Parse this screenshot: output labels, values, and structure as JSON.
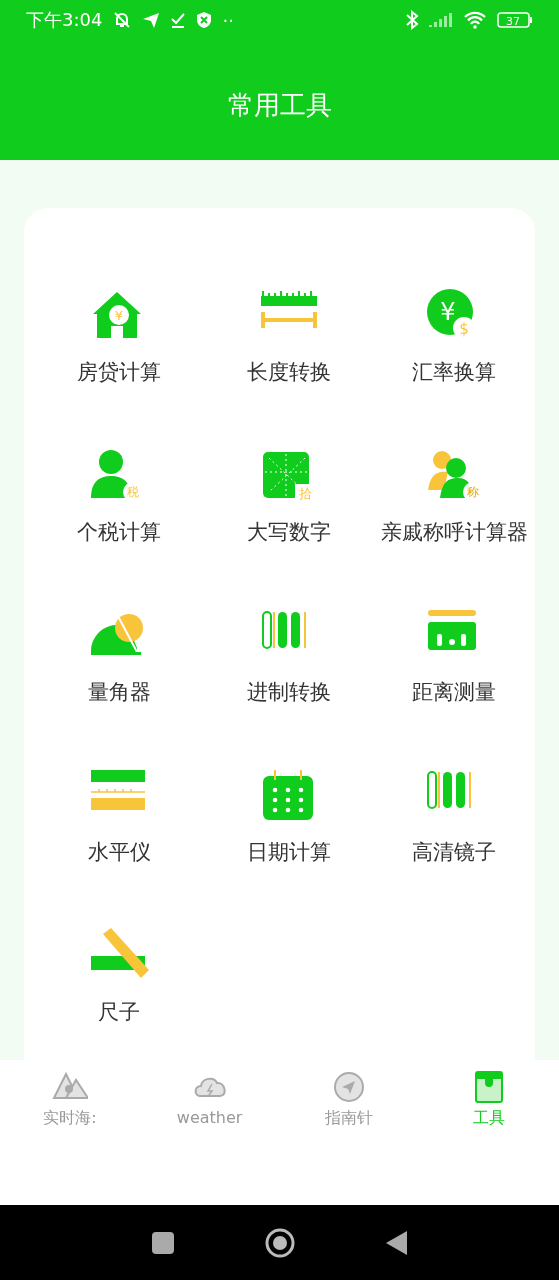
{
  "status_bar": {
    "time": "下午3:04",
    "more": "··",
    "battery": "37"
  },
  "header": {
    "title": "常用工具"
  },
  "tools": [
    {
      "kind": "house",
      "badge": "¥",
      "label": "房贷计算"
    },
    {
      "kind": "ruler",
      "label": "长度转换"
    },
    {
      "kind": "currency",
      "badge": "¥",
      "badge2": "$",
      "label": "汇率换算"
    },
    {
      "kind": "tax",
      "badge": "税",
      "label": "个税计算"
    },
    {
      "kind": "square",
      "badge": "拾",
      "label": "大写数字"
    },
    {
      "kind": "people",
      "badge": "称",
      "label": "亲戚称呼计算器"
    },
    {
      "kind": "protractor",
      "label": "量角器"
    },
    {
      "kind": "bars",
      "label": "进制转换"
    },
    {
      "kind": "distance",
      "label": "距离测量"
    },
    {
      "kind": "level",
      "label": "水平仪"
    },
    {
      "kind": "calendar",
      "label": "日期计算"
    },
    {
      "kind": "bars",
      "label": "高清镜子"
    },
    {
      "kind": "diagonal",
      "label": "尺子"
    }
  ],
  "tabs": [
    {
      "kind": "mountain",
      "label": "实时海:",
      "selected": false
    },
    {
      "kind": "cloud",
      "label": "weather",
      "selected": false
    },
    {
      "kind": "compass",
      "label": "指南针",
      "selected": false
    },
    {
      "kind": "box",
      "label": "工具",
      "selected": true
    }
  ]
}
